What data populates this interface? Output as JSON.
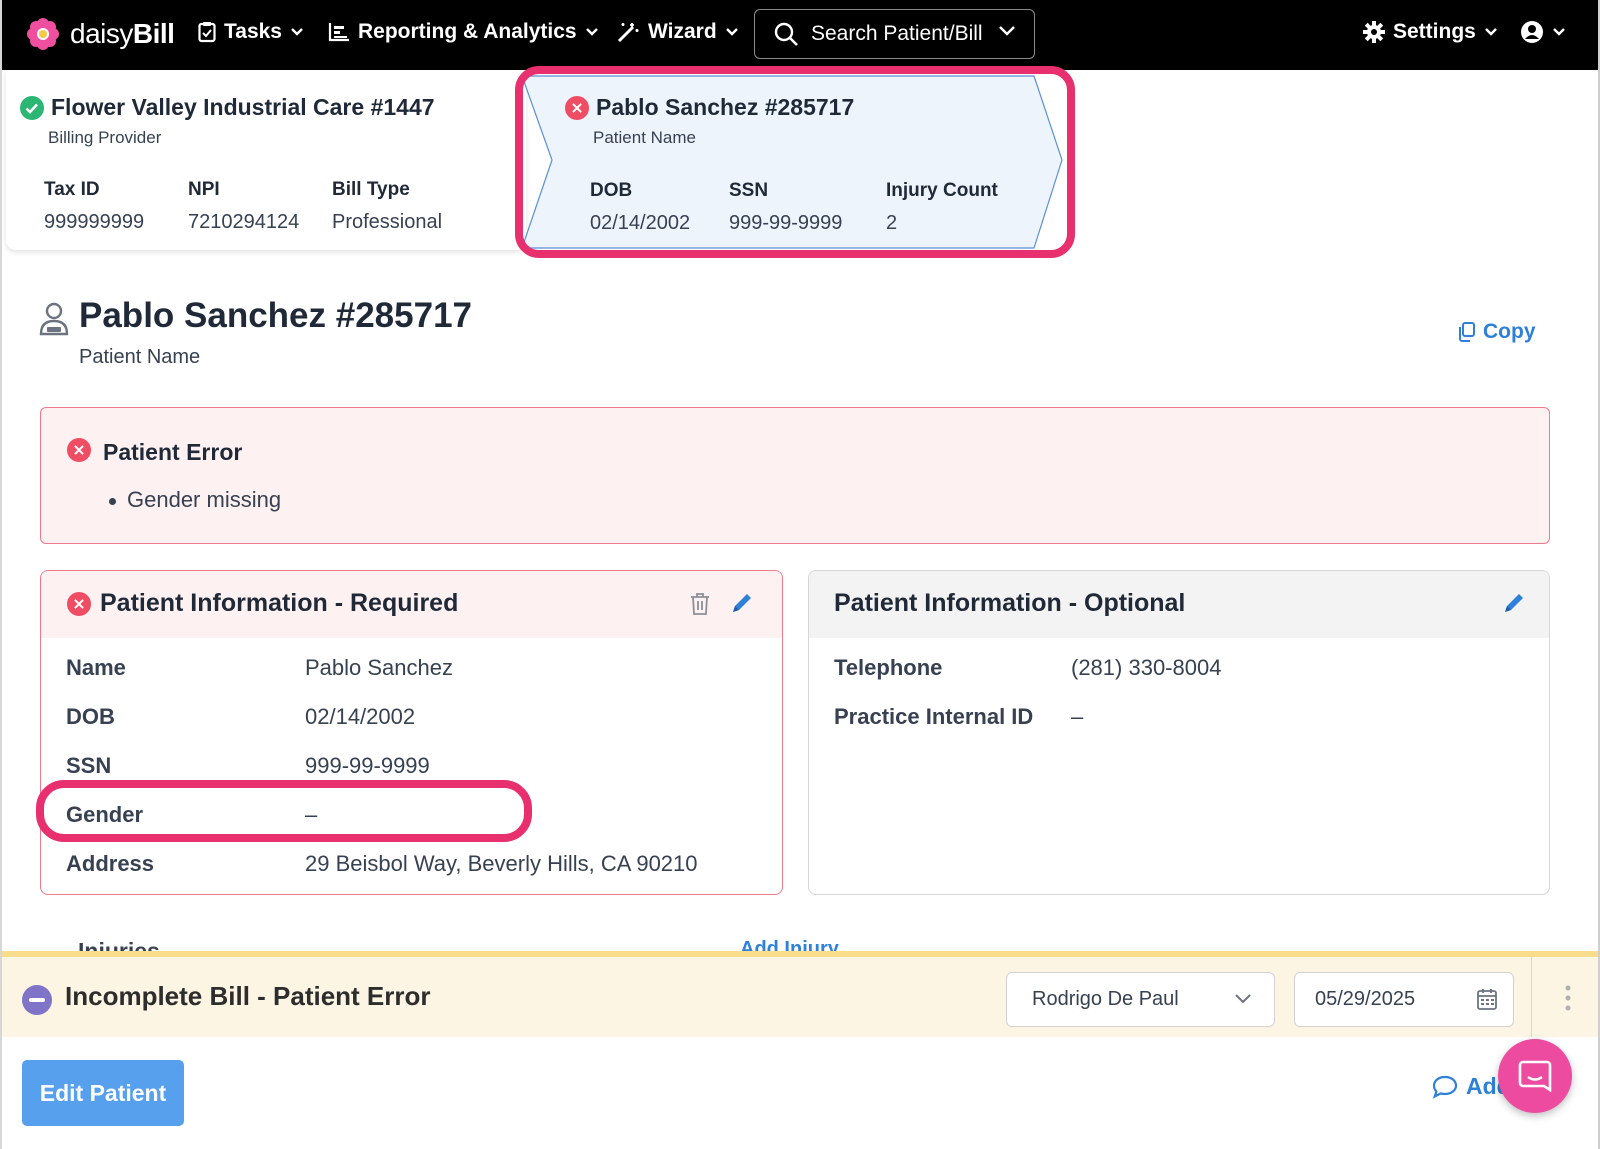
{
  "colors": {
    "nav_bg": "#000000",
    "accent_blue": "#2f80d9",
    "error_red": "#ef4d63",
    "success_green": "#2bb673",
    "highlight_pink": "#e8306f",
    "warning_bg": "#fdf5e3",
    "button_blue": "#56a0ee"
  },
  "nav": {
    "logo_prefix": "daisy",
    "logo_suffix": "Bill",
    "tasks": "Tasks",
    "reporting": "Reporting & Analytics",
    "wizard": "Wizard",
    "search_placeholder": "Search Patient/Bill",
    "settings": "Settings"
  },
  "provider_card": {
    "title": "Flower Valley Industrial Care #1447",
    "subtitle": "Billing Provider",
    "columns": [
      {
        "label": "Tax ID",
        "value": "999999999"
      },
      {
        "label": "NPI",
        "value": "7210294124"
      },
      {
        "label": "Bill Type",
        "value": "Professional"
      }
    ]
  },
  "patient_card": {
    "title": "Pablo Sanchez #285717",
    "subtitle": "Patient Name",
    "columns": [
      {
        "label": "DOB",
        "value": "02/14/2002"
      },
      {
        "label": "SSN",
        "value": "999-99-9999"
      },
      {
        "label": "Injury Count",
        "value": "2"
      }
    ]
  },
  "page": {
    "title": "Pablo Sanchez #285717",
    "subtitle": "Patient Name",
    "copy_label": "Copy"
  },
  "error": {
    "title": "Patient Error",
    "items": [
      "Gender missing"
    ]
  },
  "required_panel": {
    "title": "Patient Information - Required",
    "rows": [
      {
        "label": "Name",
        "value": "Pablo Sanchez"
      },
      {
        "label": "DOB",
        "value": "02/14/2002"
      },
      {
        "label": "SSN",
        "value": "999-99-9999"
      },
      {
        "label": "Gender",
        "value": "–"
      },
      {
        "label": "Address",
        "value": "29 Beisbol Way, Beverly Hills, CA 90210"
      }
    ]
  },
  "optional_panel": {
    "title": "Patient Information - Optional",
    "rows": [
      {
        "label": "Telephone",
        "value": "(281) 330-8004"
      },
      {
        "label": "Practice Internal ID",
        "value": "–"
      }
    ]
  },
  "injuries": {
    "title": "Injuries",
    "add_label": "Add Injury"
  },
  "status": {
    "text": "Incomplete Bill - Patient Error",
    "assignee": "Rodrigo De Paul",
    "date": "05/29/2025"
  },
  "actions": {
    "edit_patient": "Edit Patient",
    "add_note": "Add Note"
  }
}
